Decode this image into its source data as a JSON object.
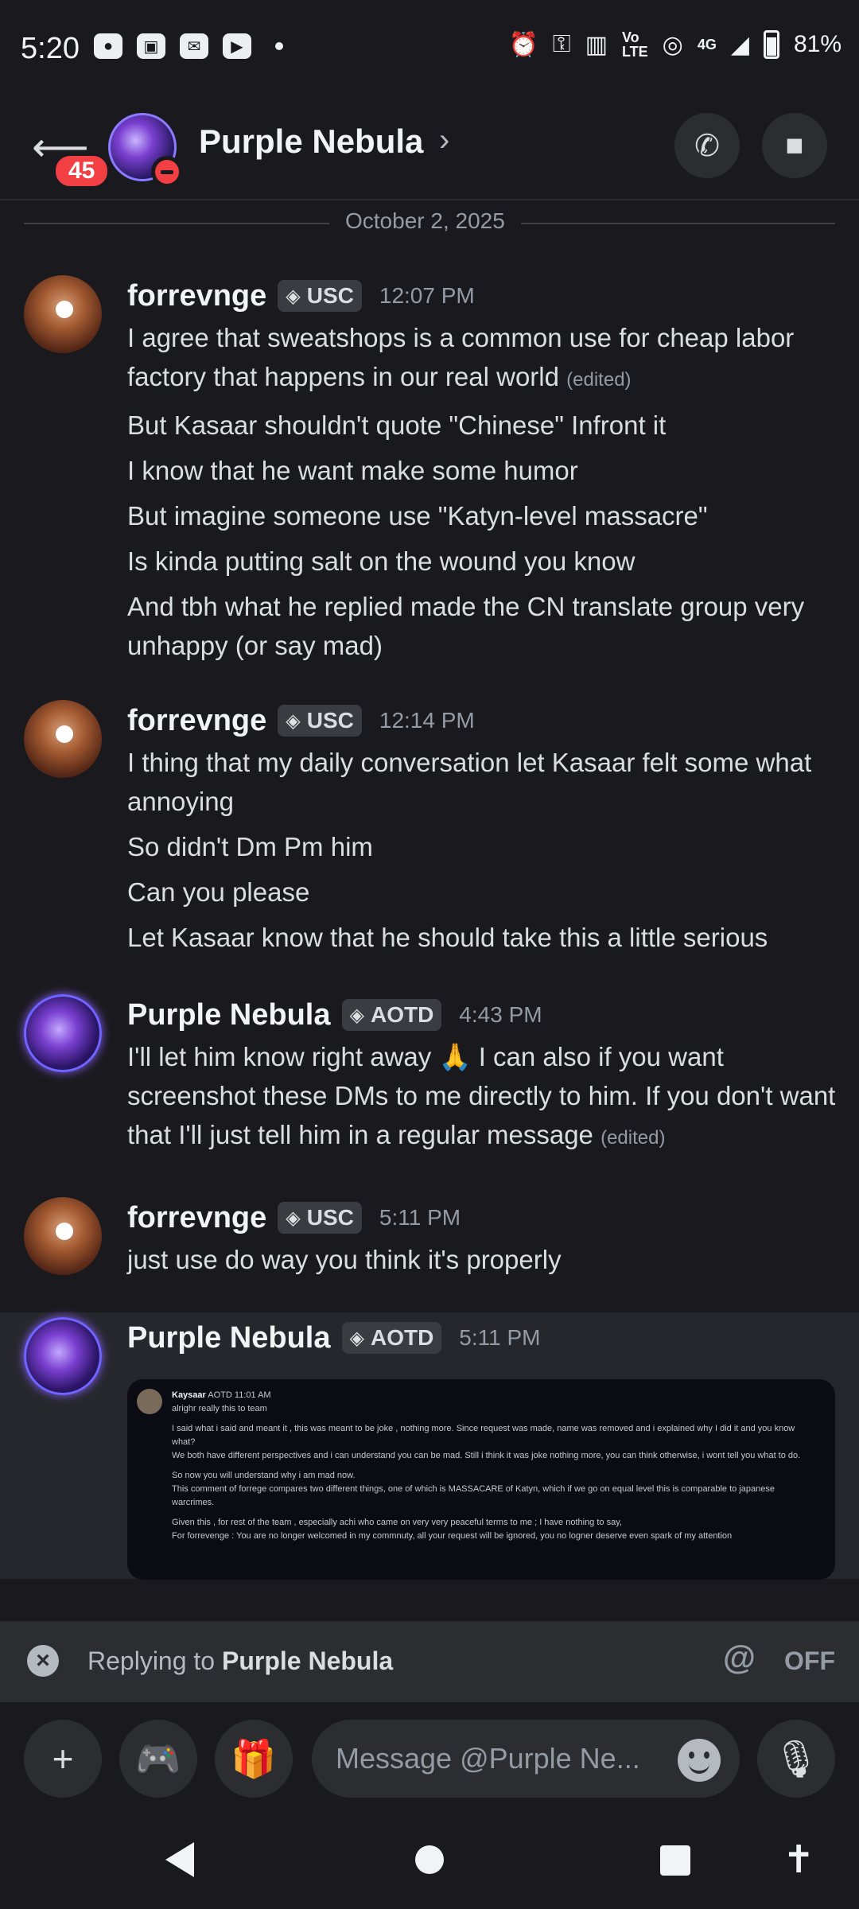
{
  "status_bar": {
    "time": "5:20",
    "network": "4G",
    "battery": "81%"
  },
  "header": {
    "unread_badge": "45",
    "title": "Purple Nebula"
  },
  "date_divider": "October 2, 2025",
  "messages": [
    {
      "author": "forrevnge",
      "tag": "USC",
      "time": "12:07 PM",
      "lines": [
        "I agree that sweatshops is a common use for cheap labor factory that happens in our real world",
        "But Kasaar shouldn't quote \"Chinese\" Infront it",
        "I know that he want make some humor",
        "But imagine someone use \"Katyn-level massacre\"",
        "Is kinda putting salt on the wound you know",
        "And tbh what he replied made the CN translate group very unhappy (or say mad)"
      ],
      "edited_label": "(edited)"
    },
    {
      "author": "forrevnge",
      "tag": "USC",
      "time": "12:14 PM",
      "lines": [
        "I thing that my daily conversation let Kasaar felt some what annoying",
        "So didn't Dm Pm him",
        "Can you please",
        "Let Kasaar know that he should take this a little serious"
      ]
    },
    {
      "author": "Purple Nebula",
      "tag": "AOTD",
      "time": "4:43 PM",
      "lines": [
        "I'll let him know right away 🙏 I can also if you want screenshot these DMs to me directly to him. If you don't want that I'll just tell him in a regular message"
      ],
      "edited_label": "(edited)"
    },
    {
      "author": "forrevnge",
      "tag": "USC",
      "time": "5:11 PM",
      "lines": [
        "just use do way you think it's properly"
      ]
    },
    {
      "author": "Purple Nebula",
      "tag": "AOTD",
      "time": "5:11 PM",
      "attachment": {
        "author": "Kaysaar",
        "tag": "AOTD",
        "time": "11:01 AM",
        "lines": [
          "alrighr really this to team",
          "I said what i said and meant it , this was meant to be joke , nothing more. Since request was made, name was removed and i explained why I did it and you know what?",
          "We both have different perspectives and i can understand you can be mad.  Still i think it was joke nothing more, you can think otherwise, i wont tell you what to do.",
          "So now you will understand why i am mad now.",
          "This comment of forrege compares two different things, one of which is MASSACARE of Katyn, which if we go on equal level this is comparable to japanese warcrimes.",
          "Given this , for rest of the team , especially achi who came on very very peaceful terms to me ; I have nothing to say,",
          "For forrevenge : You are no longer welcomed in my commnuty, all your request will be ignored, you no logner deserve even spark of my attention"
        ]
      }
    }
  ],
  "reply_bar": {
    "prefix": "Replying to",
    "target": "Purple Nebula",
    "mention": "@",
    "mention_state": "OFF"
  },
  "composer": {
    "placeholder": "Message @Purple Ne..."
  }
}
